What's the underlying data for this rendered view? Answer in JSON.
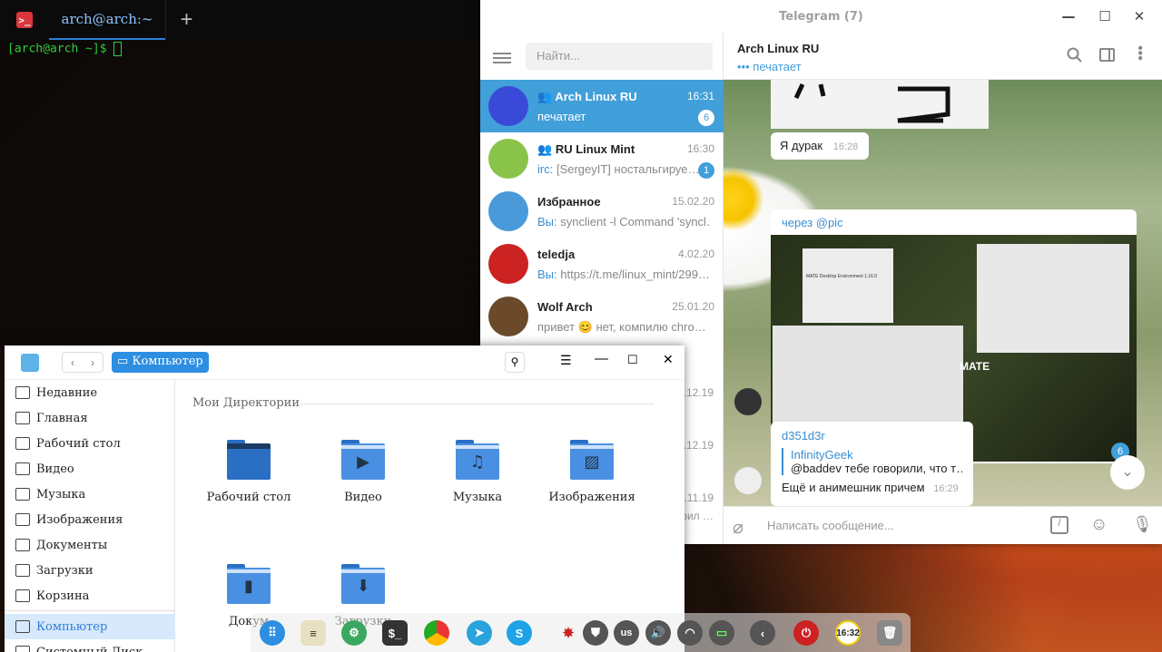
{
  "terminal": {
    "tab_title": "arch@arch:~",
    "new_tab": "+",
    "prompt": "[arch@arch ~]$",
    "icon": ">_"
  },
  "telegram": {
    "title": "Telegram (7)",
    "search_placeholder": "Найти...",
    "chats": [
      {
        "name": "Arch Linux RU",
        "time": "16:31",
        "preview": "печатает",
        "badge": "6",
        "color": "#3a4ad8",
        "group": true
      },
      {
        "name": "RU Linux Mint",
        "time": "16:30",
        "prefix": "irc:",
        "preview": " [SergeyIT] ностальгируе…",
        "badge": "1",
        "color": "#8ac34a",
        "group": true
      },
      {
        "name": "Избранное",
        "time": "15.02.20",
        "prefix": "Вы:",
        "preview": " synclient -l  Command 'syncl…",
        "color": "#4a9ad9"
      },
      {
        "name": "teledja",
        "time": "4.02.20",
        "prefix": "Вы:",
        "preview": " https://t.me/linux_mint/299…",
        "color": "#cc2222"
      },
      {
        "name": "Wolf Arch",
        "time": "25.01.20",
        "preview": "привет 😊 нет, компилю chro…",
        "color": "#6a4a2a"
      }
    ],
    "hidden_times": [
      ".12.19",
      ".12.19",
      ".11.19"
    ],
    "hidden_preview": "рил …",
    "header": {
      "name": "Arch Linux RU",
      "status": "печатает"
    },
    "messages": {
      "m1_text": "Я дурак",
      "m1_time": "16:28",
      "m2_author": "через @pic",
      "m3_author": "d351d3r",
      "m3_reply_name": "InfinityGeek",
      "m3_reply_text": "@baddev тебе говорили, что т…",
      "m3_text": "Ещё и анимешник причем",
      "m3_time": "16:29"
    },
    "scroll_badge": "6",
    "input_placeholder": "Написать сообщение..."
  },
  "filemanager": {
    "location": "Компьютер",
    "section_title": "Мои Директории",
    "sidebar": [
      "Недавние",
      "Главная",
      "Рабочий стол",
      "Видео",
      "Музыка",
      "Изображения",
      "Документы",
      "Загрузки",
      "Корзина",
      "Компьютер",
      "Системный Диск"
    ],
    "folders": [
      "Рабочий стол",
      "Видео",
      "Музыка",
      "Изображения",
      "Докум",
      "Загрузки"
    ]
  },
  "screenshot_text": {
    "mate_title": "MATE Desktop Environment 1.16.0",
    "mate": "MATE"
  },
  "dock": {
    "lang": "us",
    "clock": "16:32"
  }
}
